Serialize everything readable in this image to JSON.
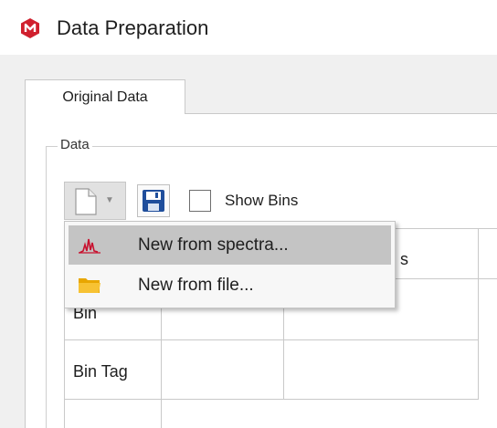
{
  "window": {
    "title": "Data Preparation",
    "icon": "app-logo-icon"
  },
  "tabs": [
    {
      "label": "Original Data",
      "active": true
    }
  ],
  "group": {
    "label": "Data"
  },
  "toolbar": {
    "new_button_icon": "new-document-icon",
    "save_button_icon": "save-icon",
    "show_bins": {
      "label": "Show Bins",
      "checked": false
    }
  },
  "grid": {
    "visible_header_fragment": "s",
    "row_headers": [
      "Bin",
      "Bin Tag"
    ]
  },
  "menu": {
    "items": [
      {
        "label": "New from spectra...",
        "icon": "spectra-icon",
        "highlighted": true
      },
      {
        "label": "New from file...",
        "icon": "folder-icon",
        "highlighted": false
      }
    ]
  },
  "colors": {
    "logo": "#d0202e",
    "spectra_icon": "#c8102e",
    "folder_icon": "#f2b400",
    "save_icon": "#1f4e9c",
    "menu_highlight": "#c4c4c4",
    "client_bg": "#f0f0f0"
  }
}
